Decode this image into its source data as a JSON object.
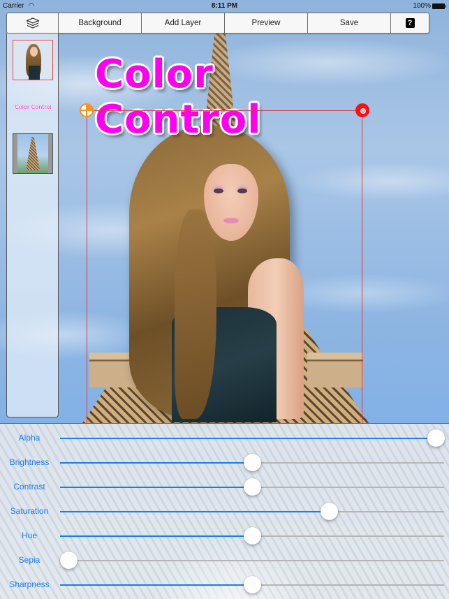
{
  "status_bar": {
    "carrier": "Carrier",
    "time": "8:11 PM",
    "battery": "100%"
  },
  "toolbar": {
    "layers_icon": "layers-icon",
    "background_label": "Background",
    "add_layer_label": "Add Layer",
    "preview_label": "Preview",
    "save_label": "Save",
    "help_label": "?"
  },
  "layers": {
    "items": [
      {
        "type": "image",
        "name": "person-layer",
        "selected": true
      },
      {
        "type": "text",
        "label": "Color Control",
        "selected": false
      },
      {
        "type": "image",
        "name": "background-layer",
        "selected": false
      }
    ]
  },
  "canvas": {
    "title_text": "Color Control",
    "title_color": "#ff00ee",
    "selection_color": "#e2363f",
    "rotate_handle_color": "#f7941d",
    "delete_handle_color": "#ff1010"
  },
  "controls": {
    "accent": "#1a7cf0",
    "sliders": [
      {
        "label": "Alpha",
        "value": 1.0
      },
      {
        "label": "Brightness",
        "value": 0.5
      },
      {
        "label": "Contrast",
        "value": 0.5
      },
      {
        "label": "Saturation",
        "value": 0.71
      },
      {
        "label": "Hue",
        "value": 0.5
      },
      {
        "label": "Sepia",
        "value": 0.0
      },
      {
        "label": "Sharpness",
        "value": 0.5
      }
    ]
  }
}
